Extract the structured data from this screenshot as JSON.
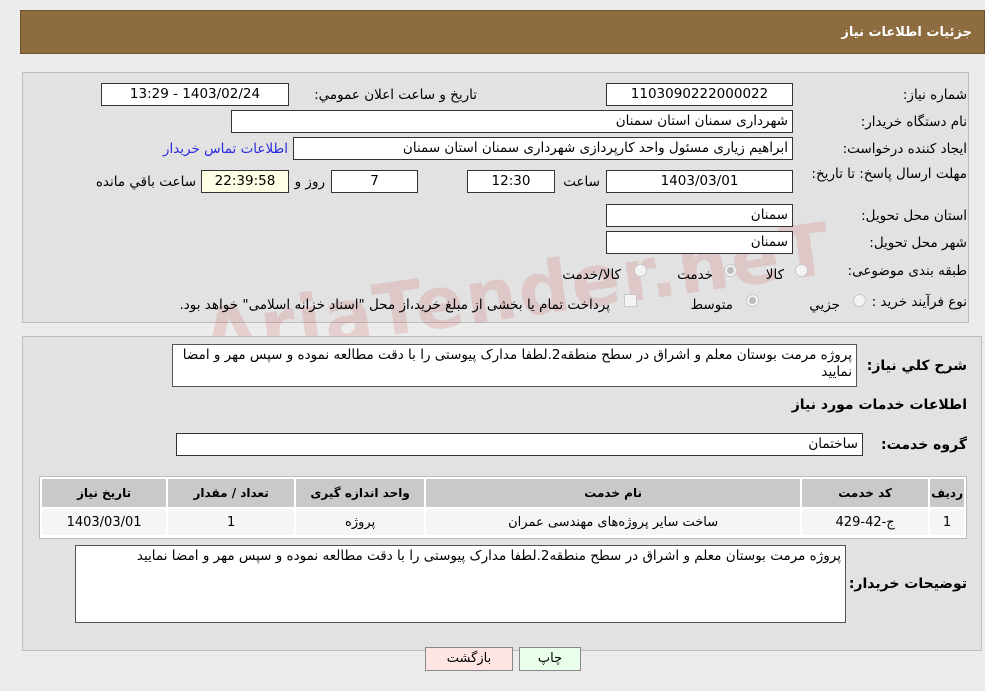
{
  "header": {
    "title": "جزئیات اطلاعات نیاز"
  },
  "form": {
    "need_number_label": "شماره نیاز:",
    "need_number": "1103090222000022",
    "announce_label": "تاریخ و ساعت اعلان عمومي:",
    "announce_value": "1403/02/24 - 13:29",
    "buyer_org_label": "نام دستگاه خریدار:",
    "buyer_org": "شهرداری سمنان استان سمنان",
    "creator_label": "ایجاد کننده درخواست:",
    "creator": "ابراهیم زیاری مسئول واحد کارپردازی شهرداری سمنان استان سمنان",
    "contact_link": "اطلاعات تماس خریدار",
    "deadline_label": "مهلت ارسال پاسخ: تا تاریخ:",
    "deadline_date": "1403/03/01",
    "time_label": "ساعت",
    "deadline_time": "12:30",
    "days": "7",
    "days_label": "روز و",
    "remaining": "22:39:58",
    "remaining_label": "ساعت باقي مانده",
    "province_label": "استان محل تحویل:",
    "province": "سمنان",
    "city_label": "شهر محل تحویل:",
    "city": "سمنان",
    "category_label": "طبقه بندی موضوعی:",
    "category_options": [
      {
        "label": "کالا",
        "selected": false
      },
      {
        "label": "خدمت",
        "selected": true
      },
      {
        "label": "کالا/خدمت",
        "selected": false
      }
    ],
    "process_label": "نوع فرآیند خرید :",
    "process_options": [
      {
        "label": "جزيي",
        "selected": false
      },
      {
        "label": "متوسط",
        "selected": true
      }
    ],
    "treasury_checked": false,
    "treasury_text": "پرداخت تمام یا بخشی از مبلغ خرید،از محل \"اسناد خزانه اسلامی\" خواهد بود."
  },
  "watermark": "AriaTender.neT",
  "details": {
    "desc_label": "شرح کلي نیاز:",
    "desc": "پروژه مرمت بوستان معلم و اشراق در سطح منطقه2.لطفا مدارک پیوستی را با دقت مطالعه نموده و سپس مهر و امضا نمایید",
    "services_title": "اطلاعات خدمات مورد نیاز",
    "group_label": "گروه خدمت:",
    "group": "ساختمان",
    "table": {
      "headers": [
        "ردیف",
        "کد خدمت",
        "نام خدمت",
        "واحد اندازه گیری",
        "تعداد / مقدار",
        "تاریخ نیاز"
      ],
      "rows": [
        [
          "1",
          "ج-42-429",
          "ساخت سایر پروژه‌های مهندسی عمران",
          "پروژه",
          "1",
          "1403/03/01"
        ]
      ]
    },
    "buyer_notes_label": "توضیحات خریدار:",
    "buyer_notes": "پروژه مرمت بوستان معلم و اشراق در سطح منطقه2.لطفا مدارک پیوستی را با دقت مطالعه نموده و سپس مهر و امضا نمایید"
  },
  "buttons": {
    "print": "چاپ",
    "back": "بازگشت"
  }
}
